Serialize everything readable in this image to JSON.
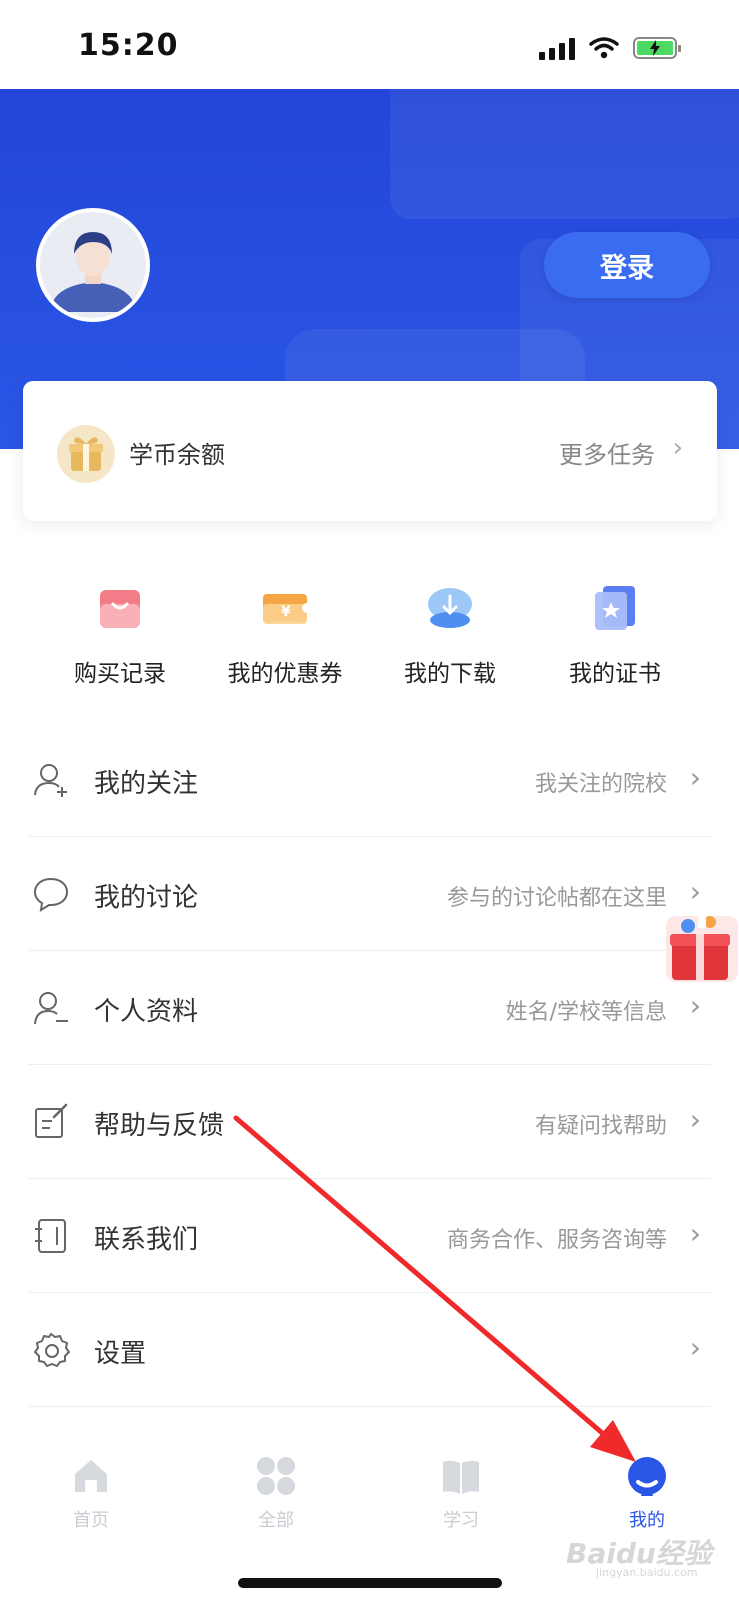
{
  "status_bar": {
    "time": "15:20"
  },
  "header": {
    "login_label": "登录"
  },
  "balance_card": {
    "label": "学币余额",
    "more_label": "更多任务",
    "chevron": "›"
  },
  "quick_actions": [
    {
      "label": "购买记录",
      "icon": "shopping-bag-icon"
    },
    {
      "label": "我的优惠券",
      "icon": "coupon-icon"
    },
    {
      "label": "我的下载",
      "icon": "cloud-download-icon"
    },
    {
      "label": "我的证书",
      "icon": "certificate-icon"
    }
  ],
  "menu": [
    {
      "title": "我的关注",
      "subtitle": "我关注的院校",
      "icon": "user-plus-icon"
    },
    {
      "title": "我的讨论",
      "subtitle": "参与的讨论帖都在这里",
      "icon": "chat-bubble-icon"
    },
    {
      "title": "个人资料",
      "subtitle": "姓名/学校等信息",
      "icon": "profile-icon"
    },
    {
      "title": "帮助与反馈",
      "subtitle": "有疑问找帮助",
      "icon": "edit-note-icon"
    },
    {
      "title": "联系我们",
      "subtitle": "商务合作、服务咨询等",
      "icon": "address-book-icon"
    },
    {
      "title": "设置",
      "subtitle": "",
      "icon": "gear-icon"
    }
  ],
  "chevron": "›",
  "tabbar": [
    {
      "label": "首页",
      "icon": "home-icon",
      "active": false
    },
    {
      "label": "全部",
      "icon": "grid-icon",
      "active": false
    },
    {
      "label": "学习",
      "icon": "book-icon",
      "active": false
    },
    {
      "label": "我的",
      "icon": "person-icon",
      "active": true
    }
  ],
  "watermark": {
    "text": "Baidu经验",
    "sub": "jingyan.baidu.com"
  },
  "colors": {
    "primary": "#2a56e6",
    "tab_inactive": "#c9ccd2",
    "annotation_arrow": "#f02a2a"
  }
}
